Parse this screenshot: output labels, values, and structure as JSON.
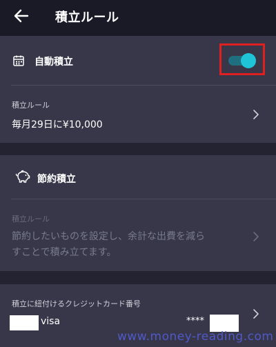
{
  "header": {
    "title": "積立ルール",
    "back_icon": "arrow-left-icon"
  },
  "auto_saving": {
    "title": "自動積立",
    "icon": "calendar-icon",
    "toggle_on": true,
    "rule_label": "積立ルール",
    "rule_value": "毎月29日に¥10,000"
  },
  "budget_saving": {
    "title": "節約積立",
    "icon": "piggy-bank-icon",
    "rule_label": "積立ルール",
    "description_line1": "節約したいものを設定し、余計な出費を減ら",
    "description_line2": "すことで積み立てます。"
  },
  "credit_card": {
    "label": "積立に紐付けるクレジットカード番号",
    "brand": "visa",
    "masked": "****"
  },
  "watermark": "www.money-reading.com",
  "colors": {
    "background": "#232331",
    "card": "#373749",
    "header": "#1a1a27",
    "toggle_accent": "#1fc4d8",
    "highlight": "#e02020"
  }
}
